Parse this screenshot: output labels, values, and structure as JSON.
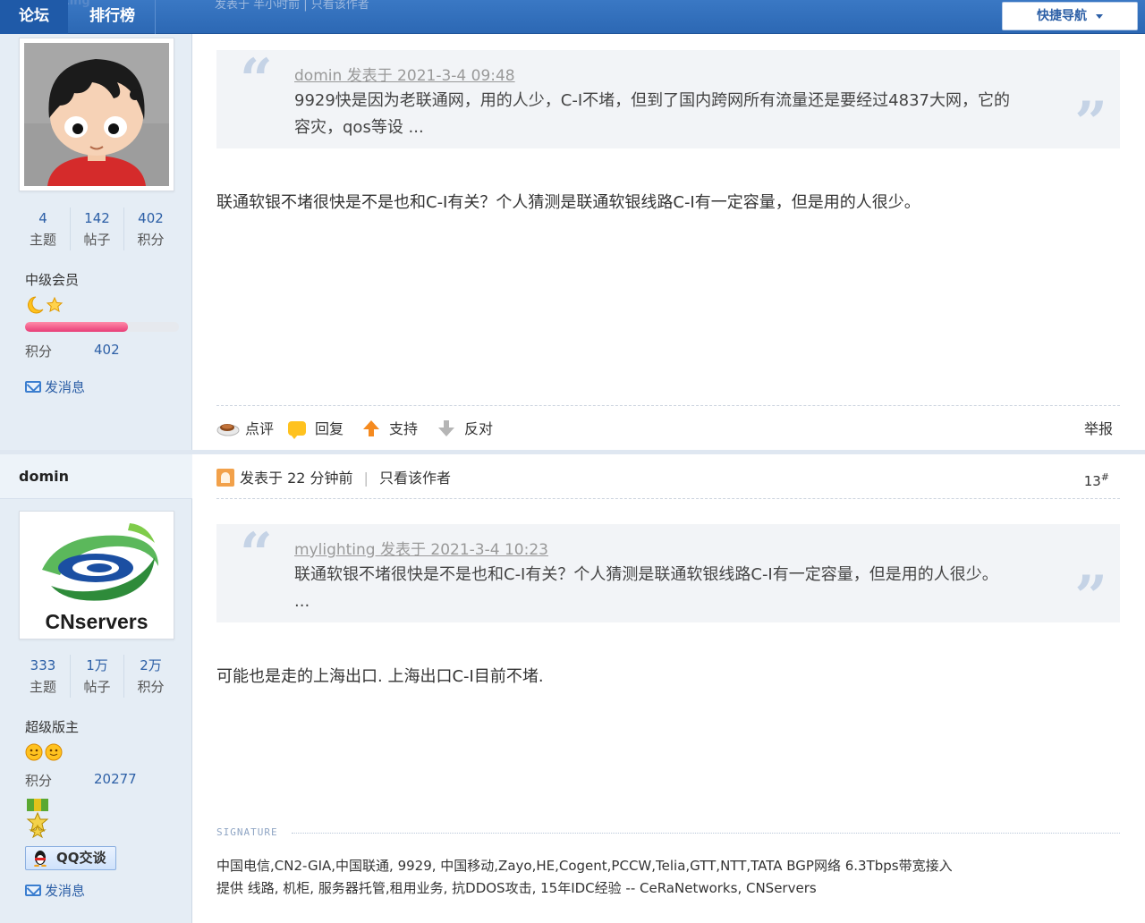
{
  "nav": {
    "forum": "论坛",
    "rank": "排行榜",
    "ghost_user": "mylighting",
    "ghost_text": "发表于 半小时前  |  只看该作者",
    "quick_nav": "快捷导航"
  },
  "post1": {
    "author": {
      "threads": "4",
      "threads_label": "主题",
      "posts": "142",
      "posts_label": "帖子",
      "points": "402",
      "points_label": "积分",
      "rank_title": "中级会员",
      "points_row_label": "积分",
      "points_row_value": "402",
      "message": "发消息",
      "progress": 0.67
    },
    "quote": {
      "header": "domin 发表于 2021-3-4 09:48",
      "line1": "9929快是因为老联通网，用的人少，C-I不堵，但到了国内跨网所有流量还是要经过4837大网，它的",
      "line2": "容灾，qos等设 ..."
    },
    "text": "联通软银不堵很快是不是也和C-I有关？个人猜测是联通软银线路C-I有一定容量，但是用的人很少。",
    "actions": {
      "comment": "点评",
      "reply": "回复",
      "support": "支持",
      "oppose": "反对",
      "report": "举报"
    }
  },
  "post2": {
    "author": {
      "name": "domin",
      "logo_text": "CNservers",
      "threads": "333",
      "threads_label": "主题",
      "posts": "1万",
      "posts_label": "帖子",
      "points": "2万",
      "points_label": "积分",
      "rank_title": "超级版主",
      "points_row_label": "积分",
      "points_row_value": "20277",
      "qq": "QQ交谈",
      "message": "发消息"
    },
    "header": {
      "posted": "发表于 22 分钟前",
      "only_author": "只看该作者",
      "floor": "13",
      "floor_mark": "#"
    },
    "quote": {
      "header": "mylighting 发表于 2021-3-4 10:23",
      "line1": "联通软银不堵很快是不是也和C-I有关？个人猜测是联通软银线路C-I有一定容量，但是用的人很少。",
      "line2": "..."
    },
    "text": "可能也是走的上海出口. 上海出口C-I目前不堵.",
    "signature_label": "SIGNATURE",
    "signature_line1": "中国电信,CN2-GIA,中国联通, 9929, 中国移动,Zayo,HE,Cogent,PCCW,Telia,GTT,NTT,TATA BGP网络 6.3Tbps带宽接入",
    "signature_line2": "提供 线路, 机柜, 服务器托管,租用业务, 抗DDOS攻击, 15年IDC经验 -- CeRaNetworks, CNServers"
  },
  "colors": {
    "nav_blue": "#2c68b4",
    "link_blue": "#2c5fa6",
    "sidebar_bg": "#e5edf5",
    "quote_bg": "#f2f4f7"
  }
}
